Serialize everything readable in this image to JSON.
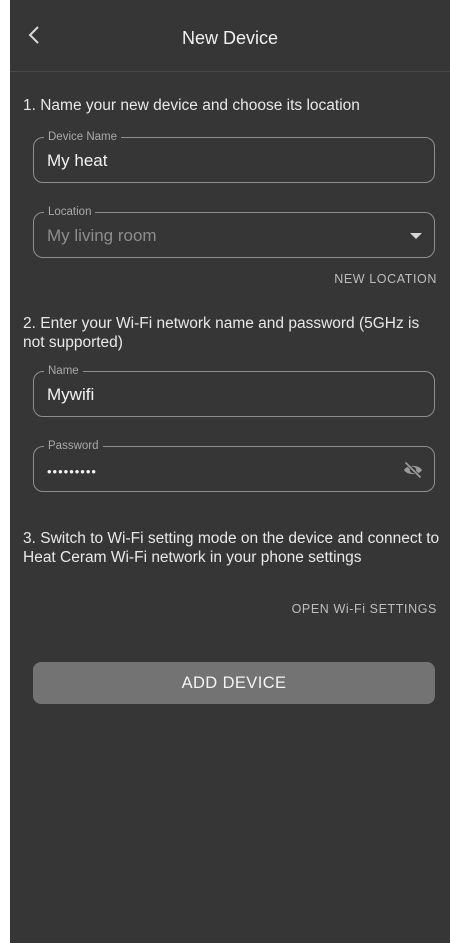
{
  "header": {
    "title": "New Device",
    "back_icon": "chevron-left-icon"
  },
  "step1": {
    "label": "1. Name your new device and choose its location",
    "device_name": {
      "label": "Device Name",
      "value": "My heat"
    },
    "location": {
      "label": "Location",
      "value": "My living room",
      "icon": "dropdown-arrow-icon"
    },
    "new_location_link": "NEW LOCATION"
  },
  "step2": {
    "label": "2. Enter your Wi-Fi network name and password (5GHz is not supported)",
    "wifi_name": {
      "label": "Name",
      "value": "Mywifi"
    },
    "password": {
      "label": "Password",
      "value": "•••••••••",
      "icon": "eye-off-icon"
    }
  },
  "step3": {
    "label": "3. Switch to Wi-Fi setting mode on the device and connect to Heat Ceram Wi-Fi network in your phone settings",
    "open_wifi_settings_link": "OPEN Wi-Fi SETTINGS"
  },
  "add_device_button": "ADD DEVICE",
  "colors": {
    "background": "#363636",
    "field_border": "#8f8f8f",
    "button": "#737373",
    "text": "#e9e9e9"
  }
}
